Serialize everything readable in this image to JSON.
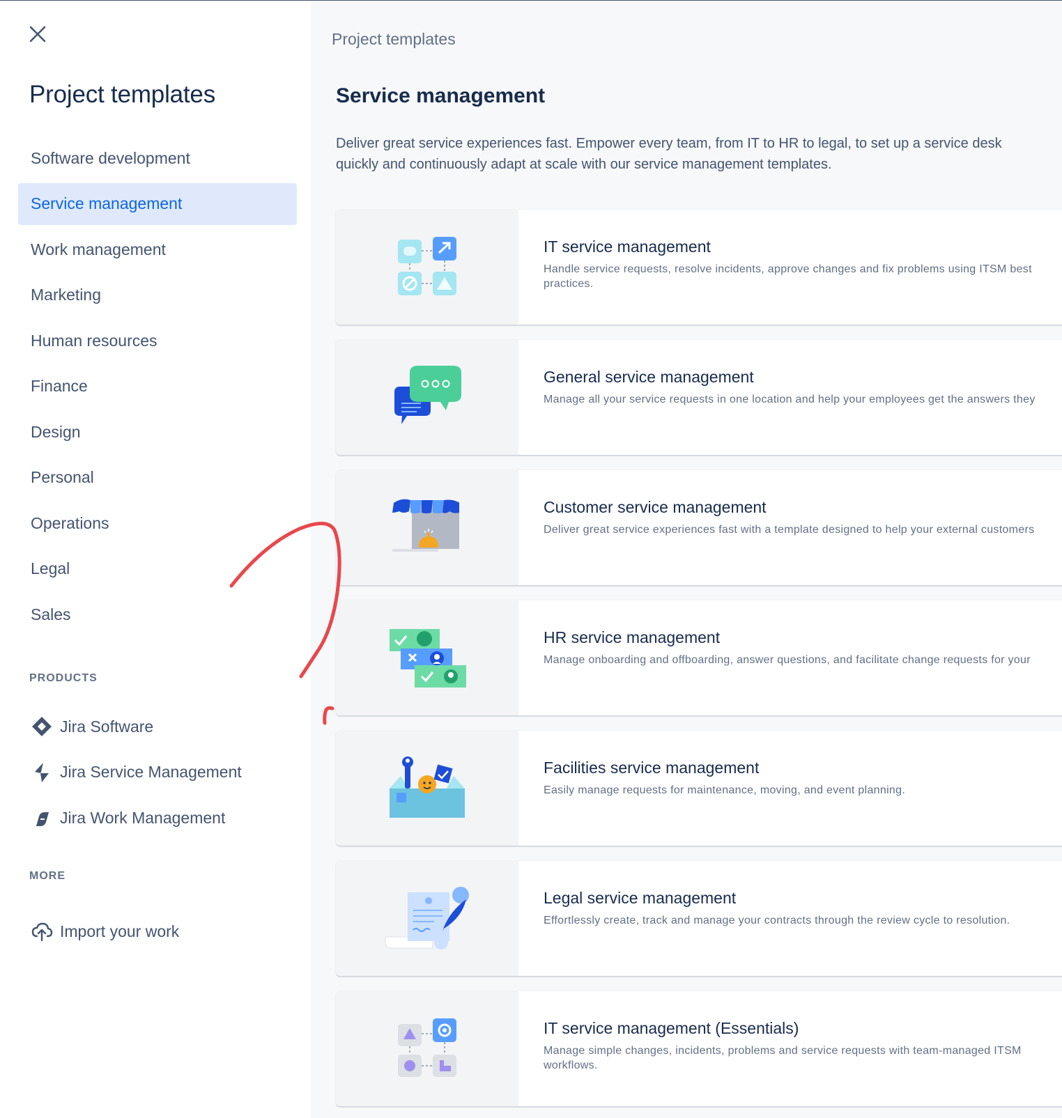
{
  "sidebar": {
    "title": "Project templates",
    "close_icon": "close-icon",
    "nav_items": [
      {
        "label": "Software development",
        "active": false
      },
      {
        "label": "Service management",
        "active": true
      },
      {
        "label": "Work management",
        "active": false
      },
      {
        "label": "Marketing",
        "active": false
      },
      {
        "label": "Human resources",
        "active": false
      },
      {
        "label": "Finance",
        "active": false
      },
      {
        "label": "Design",
        "active": false
      },
      {
        "label": "Personal",
        "active": false
      },
      {
        "label": "Operations",
        "active": false
      },
      {
        "label": "Legal",
        "active": false
      },
      {
        "label": "Sales",
        "active": false
      }
    ],
    "products_heading": "PRODUCTS",
    "products": [
      {
        "label": "Jira Software",
        "icon": "jira-software-icon"
      },
      {
        "label": "Jira Service Management",
        "icon": "jira-service-management-icon"
      },
      {
        "label": "Jira Work Management",
        "icon": "jira-work-management-icon"
      }
    ],
    "more_heading": "MORE",
    "more": [
      {
        "label": "Import your work",
        "icon": "cloud-upload-icon"
      }
    ]
  },
  "main": {
    "breadcrumb": "Project templates",
    "title": "Service management",
    "description": "Deliver great service experiences fast. Empower every team, from IT to HR to legal, to set up a service desk quickly and continuously adapt at scale with our service management templates.",
    "cards": [
      {
        "title": "IT service management",
        "description": "Handle service requests, resolve incidents, approve changes and fix problems using ITSM best practices.",
        "illustration": "itsm-illustration"
      },
      {
        "title": "General service management",
        "description": "Manage all your service requests in one location and help your employees get the answers they",
        "illustration": "chat-bubbles-illustration"
      },
      {
        "title": "Customer service management",
        "description": "Deliver great service experiences fast with a template designed to help your external customers",
        "illustration": "storefront-illustration"
      },
      {
        "title": "HR service management",
        "description": "Manage onboarding and offboarding, answer questions, and facilitate change requests for your",
        "illustration": "hr-cards-illustration"
      },
      {
        "title": "Facilities service management",
        "description": "Easily manage requests for maintenance, moving, and event planning.",
        "illustration": "toolbox-illustration"
      },
      {
        "title": "Legal service management",
        "description": "Effortlessly create, track and manage your contracts through the review cycle to resolution.",
        "illustration": "contract-quill-illustration"
      },
      {
        "title": "IT service management (Essentials)",
        "description": "Manage simple changes, incidents, problems and service requests with team-managed ITSM workflows.",
        "illustration": "itsm-essentials-illustration"
      }
    ]
  },
  "colors": {
    "active_nav_bg": "#dfe9fb",
    "active_nav_text": "#0c66e4",
    "annotation_stroke": "#e8474c"
  }
}
